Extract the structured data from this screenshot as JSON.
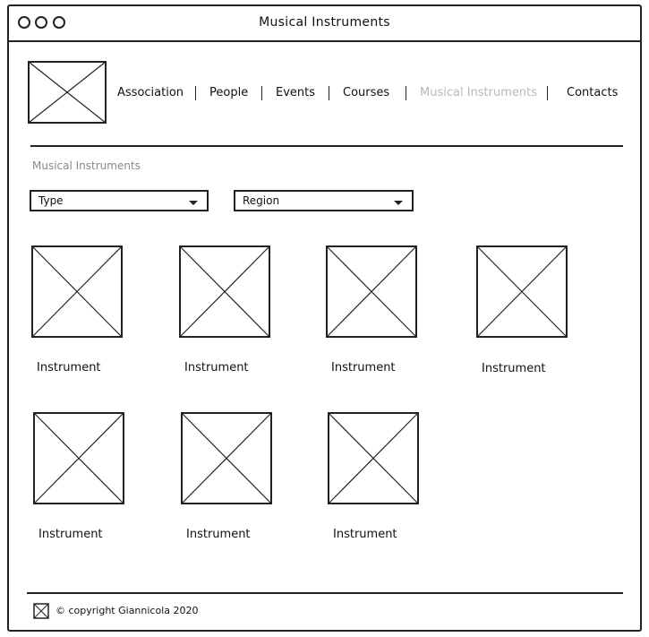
{
  "window": {
    "title": "Musical Instruments"
  },
  "nav": {
    "items": [
      {
        "label": "Association"
      },
      {
        "label": "People"
      },
      {
        "label": "Events"
      },
      {
        "label": "Courses"
      },
      {
        "label": "Musical Instruments"
      },
      {
        "label": "Contacts"
      }
    ],
    "active": "Musical Instruments"
  },
  "page": {
    "heading": "Musical Instruments"
  },
  "filters": {
    "type": {
      "label": "Type"
    },
    "region": {
      "label": "Region"
    }
  },
  "instruments": [
    {
      "caption": "Instrument"
    },
    {
      "caption": "Instrument"
    },
    {
      "caption": "Instrument"
    },
    {
      "caption": "Instrument"
    },
    {
      "caption": "Instrument"
    },
    {
      "caption": "Instrument"
    },
    {
      "caption": "Instrument"
    }
  ],
  "footer": {
    "copyright": "© copyright Giannicola 2020"
  },
  "icons": {
    "window_controls": [
      "circle-icon",
      "circle-icon",
      "circle-icon"
    ],
    "placeholder": "image-placeholder-icon",
    "dropdown": "caret-down-icon"
  }
}
